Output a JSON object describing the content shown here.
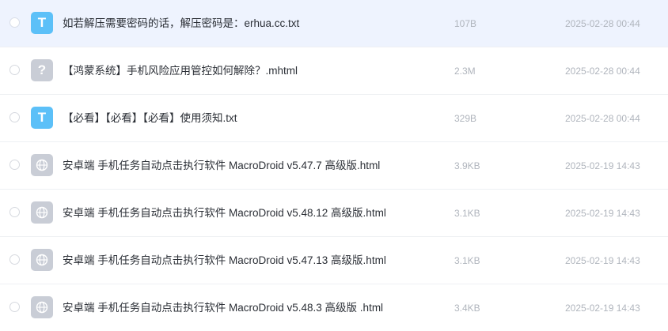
{
  "files": [
    {
      "icon": "txt-file-icon",
      "icon_glyph": "T",
      "name": "如若解压需要密码的话，解压密码是：erhua.cc.txt",
      "size": "107B",
      "date": "2025-02-28 00:44",
      "selected": true
    },
    {
      "icon": "unknown-file-icon",
      "icon_glyph": "?",
      "name": "【鸿蒙系统】手机风险应用管控如何解除？.mhtml",
      "size": "2.3M",
      "date": "2025-02-28 00:44",
      "selected": false
    },
    {
      "icon": "txt-file-icon",
      "icon_glyph": "T",
      "name": "【必看】【必看】【必看】使用须知.txt",
      "size": "329B",
      "date": "2025-02-28 00:44",
      "selected": false
    },
    {
      "icon": "html-file-icon",
      "icon_glyph": "",
      "name": "安卓端 手机任务自动点击执行软件 MacroDroid v5.47.7 高级版.html",
      "size": "3.9KB",
      "date": "2025-02-19 14:43",
      "selected": false
    },
    {
      "icon": "html-file-icon",
      "icon_glyph": "",
      "name": "安卓端 手机任务自动点击执行软件 MacroDroid v5.48.12 高级版.html",
      "size": "3.1KB",
      "date": "2025-02-19 14:43",
      "selected": false
    },
    {
      "icon": "html-file-icon",
      "icon_glyph": "",
      "name": "安卓端 手机任务自动点击执行软件 MacroDroid v5.47.13 高级版.html",
      "size": "3.1KB",
      "date": "2025-02-19 14:43",
      "selected": false
    },
    {
      "icon": "html-file-icon",
      "icon_glyph": "",
      "name": "安卓端 手机任务自动点击执行软件 MacroDroid v5.48.3 高级版 .html",
      "size": "3.4KB",
      "date": "2025-02-19 14:43",
      "selected": false
    }
  ],
  "colors": {
    "selected_row_bg": "#eef3fe",
    "txt_icon": "#5cc0f8",
    "generic_icon": "#c9cdd6"
  }
}
